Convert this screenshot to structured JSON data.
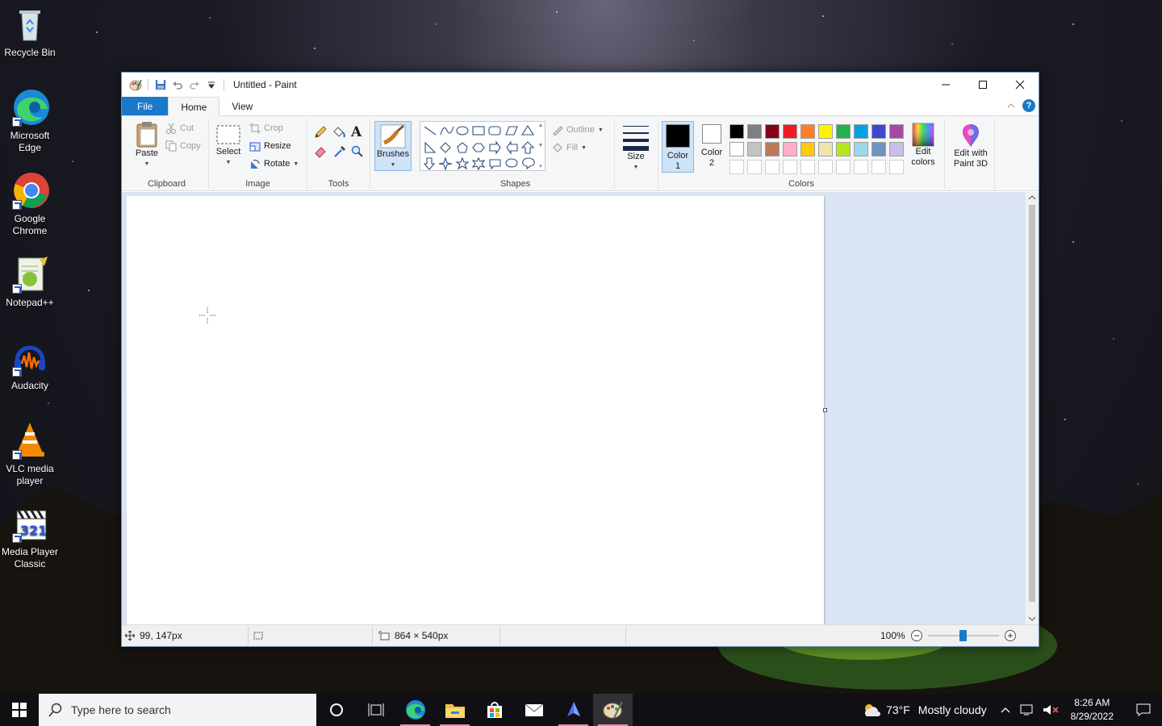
{
  "desktop": {
    "icons": [
      {
        "label": "Recycle Bin",
        "icon": "recycle-bin-icon"
      },
      {
        "label": "Microsoft Edge",
        "icon": "edge-icon"
      },
      {
        "label": "Google Chrome",
        "icon": "chrome-icon"
      },
      {
        "label": "Notepad++",
        "icon": "notepadpp-icon"
      },
      {
        "label": "Audacity",
        "icon": "audacity-icon"
      },
      {
        "label": "VLC media player",
        "icon": "vlc-icon"
      },
      {
        "label": "Media Player Classic",
        "icon": "mpc-icon"
      }
    ]
  },
  "window": {
    "title": "Untitled - Paint",
    "tabs": [
      {
        "label": "File"
      },
      {
        "label": "Home"
      },
      {
        "label": "View"
      }
    ],
    "ribbon": {
      "clipboard": {
        "group_label": "Clipboard",
        "paste": "Paste",
        "cut": "Cut",
        "copy": "Copy"
      },
      "image": {
        "group_label": "Image",
        "select": "Select",
        "crop": "Crop",
        "resize": "Resize",
        "rotate": "Rotate"
      },
      "tools": {
        "group_label": "Tools"
      },
      "brushes": {
        "label": "Brushes"
      },
      "shapes": {
        "group_label": "Shapes",
        "outline": "Outline",
        "fill": "Fill"
      },
      "size": {
        "label": "Size"
      },
      "colors": {
        "group_label": "Colors",
        "color1_label": "Color 1",
        "color2_label": "Color 2",
        "color1": "#000000",
        "color2": "#ffffff",
        "palette_row1": [
          "#000000",
          "#7f7f7f",
          "#880015",
          "#ed1c24",
          "#ff7f27",
          "#fff200",
          "#22b14c",
          "#00a2e8",
          "#3f48cc",
          "#a349a4"
        ],
        "palette_row2": [
          "#ffffff",
          "#c3c3c3",
          "#b97a57",
          "#ffaec9",
          "#ffc90e",
          "#efe4b0",
          "#b5e61d",
          "#99d9ea",
          "#7092be",
          "#c8bfe7"
        ],
        "edit_colors": "Edit colors"
      },
      "edit_3d": "Edit with Paint 3D"
    },
    "status": {
      "cursor_pos": "99, 147px",
      "canvas_size": "864 × 540px",
      "zoom": "100%",
      "zoom_level": 1.0
    }
  },
  "taskbar": {
    "search_placeholder": "Type here to search",
    "weather_temp": "73°F",
    "weather_desc": "Mostly cloudy",
    "time": "8:26 AM",
    "date": "8/29/2022"
  }
}
